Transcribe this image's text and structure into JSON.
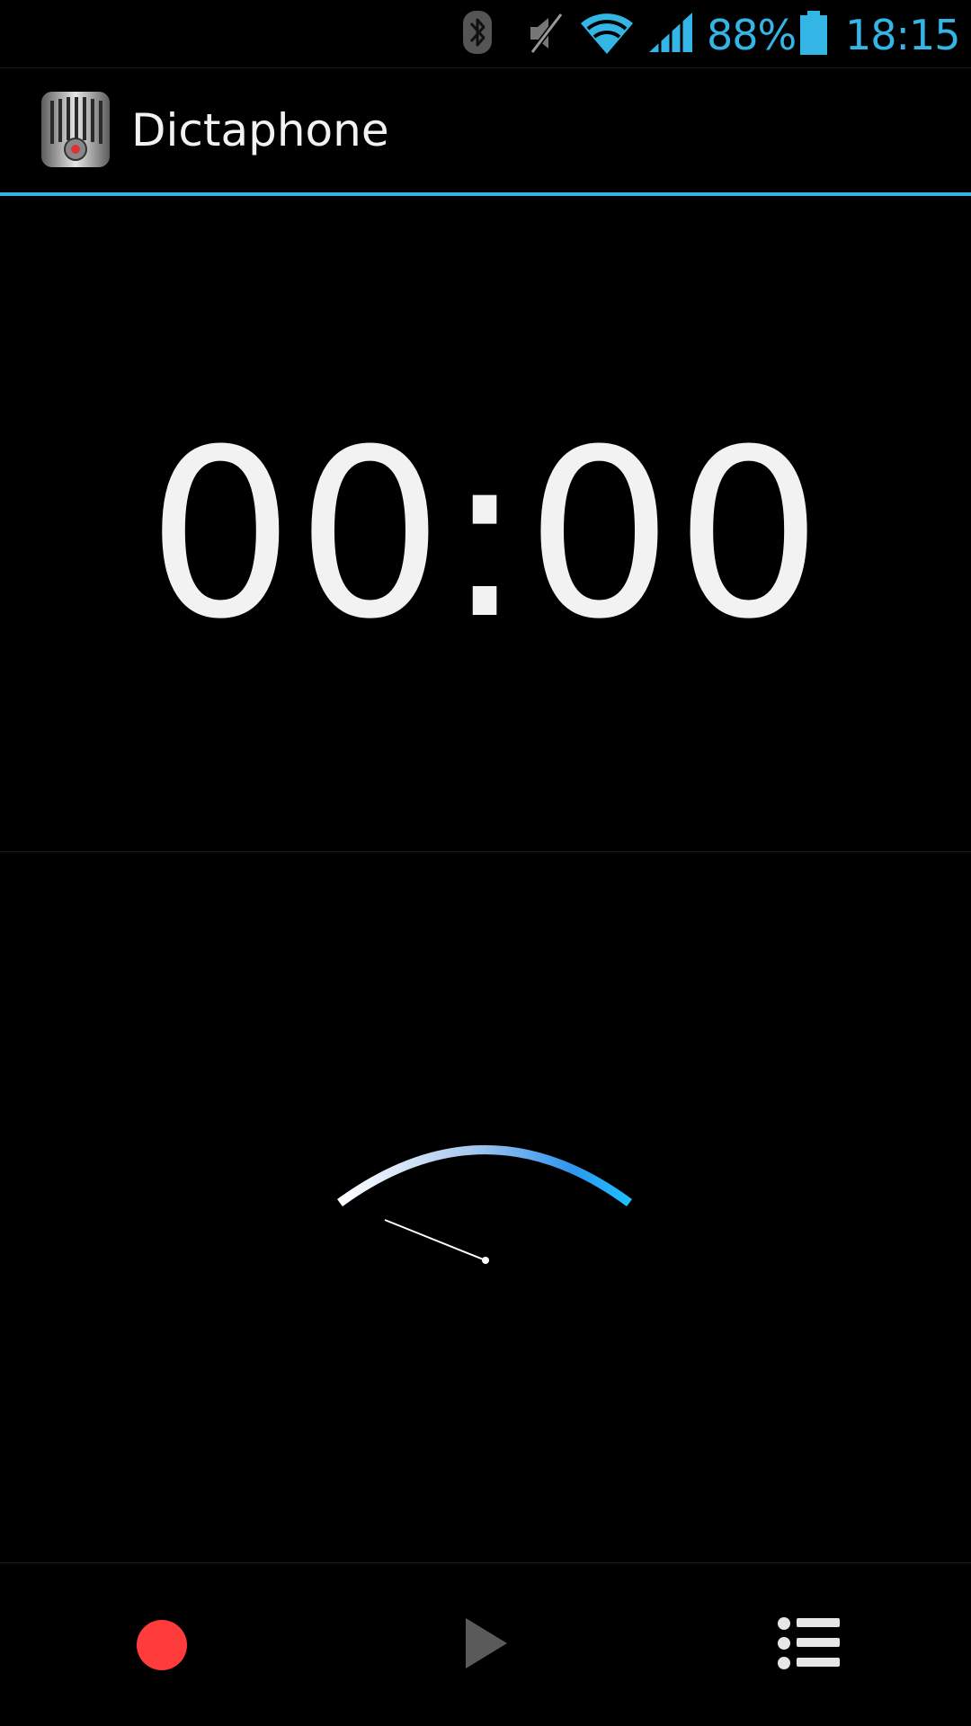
{
  "status_bar": {
    "battery_percent": "88%",
    "time": "18:15",
    "icons": [
      "bluetooth-icon",
      "mute-icon",
      "wifi-icon",
      "signal-icon",
      "battery-icon"
    ],
    "accent_color": "#33b5e5"
  },
  "action_bar": {
    "app_icon": "microphone-app-icon",
    "title": "Dictaphone",
    "underline_color": "#33b5e5"
  },
  "timer": {
    "value": "00:00"
  },
  "level_meter": {
    "level": 0
  },
  "bottom_bar": {
    "buttons": [
      {
        "name": "record",
        "icon": "record-icon",
        "color": "#ff3b3b"
      },
      {
        "name": "play",
        "icon": "play-icon",
        "color": "#5a5a5a"
      },
      {
        "name": "recordings-list",
        "icon": "list-icon",
        "color": "#e6e6e6"
      }
    ]
  }
}
